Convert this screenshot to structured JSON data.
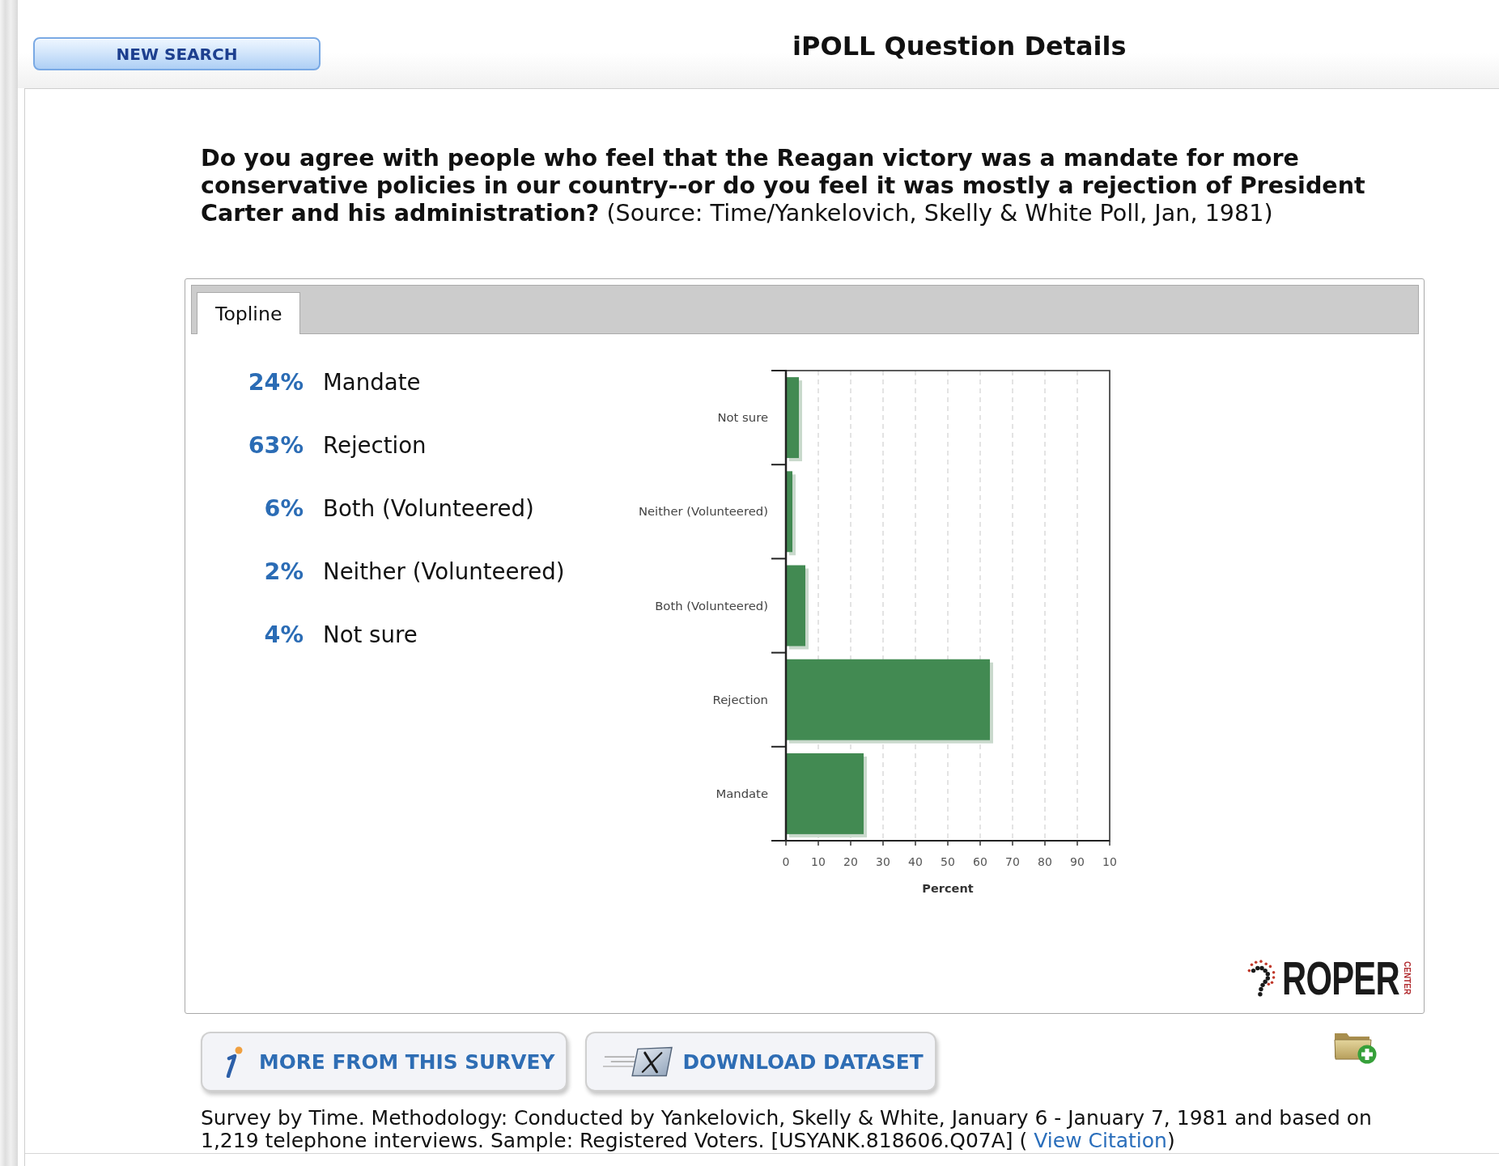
{
  "header": {
    "button": "NEW SEARCH",
    "title": "iPOLL Question Details"
  },
  "question": {
    "text": "**Do you agree with people who feel that the Reagan victory was a mandate for more conservative policies in our country--or do you feel it was mostly a rejection of President Carter and his administration?** (Source: Time/Yankelovich, Skelly & White Poll, Jan, 1981)"
  },
  "panel": {
    "tabs": [
      {
        "label": "Topline",
        "selected": true
      }
    ],
    "results": [
      {
        "percent": "24%",
        "label": "Mandate"
      },
      {
        "percent": "63%",
        "label": "Rejection"
      },
      {
        "percent": "6%",
        "label": "Both (Volunteered)"
      },
      {
        "percent": "2%",
        "label": "Neither (Volunteered)"
      },
      {
        "percent": "4%",
        "label": "Not sure"
      }
    ],
    "chart_data": {
      "type": "bar",
      "orientation": "horizontal",
      "grid": true,
      "xlabel": "Percent",
      "categories": [
        "Not sure",
        "Neither (Volunteered)",
        "Both (Volunteered)",
        "Rejection",
        "Mandate"
      ],
      "series": [
        {
          "color": "#428a52",
          "values": [
            4,
            2,
            6,
            63,
            24
          ]
        }
      ],
      "xlim": [
        0,
        100
      ],
      "xticks": [
        0,
        10,
        20,
        30,
        40,
        50,
        60,
        70,
        80,
        90
      ]
    },
    "chart_cut_tick_label": "10",
    "logo": {
      "name": "ROPER",
      "subtitle": "CENTER"
    }
  },
  "actions": [
    {
      "kind": "survey",
      "label": "MORE FROM THIS SURVEY"
    },
    {
      "kind": "dataset",
      "label": "DOWNLOAD DATASET"
    }
  ],
  "footer": {
    "text": "Survey by Time. Methodology: Conducted by Yankelovich, Skelly & White, January 6 - January 7, 1981 and based on 1,219 telephone interviews. Sample: Registered Voters. [USYANK.818606.Q07A] (",
    "link": "View Citation",
    "after": ")"
  }
}
